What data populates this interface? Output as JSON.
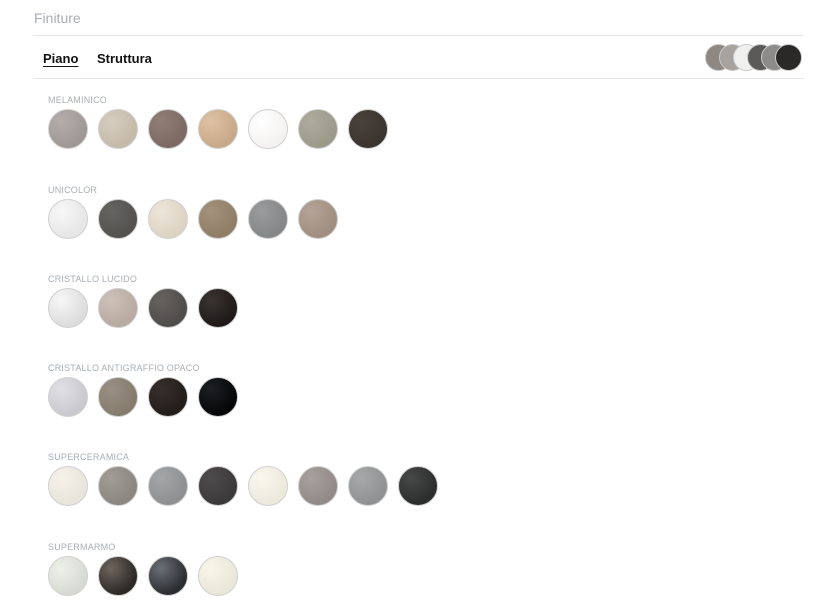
{
  "section_title": "Finiture",
  "tabs": [
    {
      "label": "Piano",
      "active": true
    },
    {
      "label": "Struttura",
      "active": false
    }
  ],
  "preview_colors": [
    "#8e8782",
    "#a7a29e",
    "#f0f0ef",
    "#5b5a59",
    "#8c8b8a",
    "#2a2928"
  ],
  "groups": [
    {
      "name": "MELAMINICO",
      "swatches": [
        {
          "color": "#9e9793",
          "accent": "#b4aeaa"
        },
        {
          "color": "#c5baa9",
          "accent": "#d6cdbf"
        },
        {
          "color": "#7c6a62",
          "accent": "#917f76"
        },
        {
          "color": "#c8a888",
          "accent": "#dec2a4"
        },
        {
          "color": "#f4f2f1",
          "accent": "#ffffff"
        },
        {
          "color": "#9b9a89",
          "accent": "#aeac9d"
        },
        {
          "color": "#3b342e",
          "accent": "#4a433c"
        }
      ]
    },
    {
      "name": "UNICOLOR",
      "swatches": [
        {
          "color": "#e6e6e6",
          "accent": "#f7f7f7"
        },
        {
          "color": "#54524f",
          "accent": "#666461"
        },
        {
          "color": "#ddd3c2",
          "accent": "#ece5d9"
        },
        {
          "color": "#8f7d66",
          "accent": "#a3927c"
        },
        {
          "color": "#858687",
          "accent": "#9a9b9c"
        },
        {
          "color": "#a08e80",
          "accent": "#b5a397"
        }
      ]
    },
    {
      "name": "CRISTALLO LUCIDO",
      "swatches": [
        {
          "color": "#dcdcdd",
          "accent": "#f7f7f7"
        },
        {
          "color": "#b8aaa1",
          "accent": "#ccc0b8"
        },
        {
          "color": "#4f4d4b",
          "accent": "#65625f"
        },
        {
          "color": "#1f1a19",
          "accent": "#3a3332"
        }
      ]
    },
    {
      "name": "CRISTALLO ANTIGRAFFIO OPACO",
      "swatches": [
        {
          "color": "#c9c8ce",
          "accent": "#e1e0e5"
        },
        {
          "color": "#857b6d",
          "accent": "#998f82"
        },
        {
          "color": "#231d1a",
          "accent": "#362f2c"
        },
        {
          "color": "#050607",
          "accent": "#1c1f22"
        }
      ]
    },
    {
      "name": "SUPERCERAMICA",
      "swatches": [
        {
          "color": "#e9e4da",
          "accent": "#f6f2ea"
        },
        {
          "color": "#8c8681",
          "accent": "#a29c97"
        },
        {
          "color": "#8e8f91",
          "accent": "#a5a6a8"
        },
        {
          "color": "#3b393a",
          "accent": "#4d4b4c"
        },
        {
          "color": "#ece8dc",
          "accent": "#faf7ee"
        },
        {
          "color": "#928a86",
          "accent": "#a8a09c"
        },
        {
          "color": "#8f9193",
          "accent": "#a6a8aa"
        },
        {
          "color": "#2c2d2d",
          "accent": "#474848"
        }
      ]
    },
    {
      "name": "SUPERMARMO",
      "swatches": [
        {
          "color": "#d7dad3",
          "accent": "#eef0ea"
        },
        {
          "color": "#2c2826",
          "accent": "#6e655f"
        },
        {
          "color": "#2a2c30",
          "accent": "#6b7078"
        },
        {
          "color": "#eae6d8",
          "accent": "#f8f5ea"
        }
      ]
    }
  ]
}
